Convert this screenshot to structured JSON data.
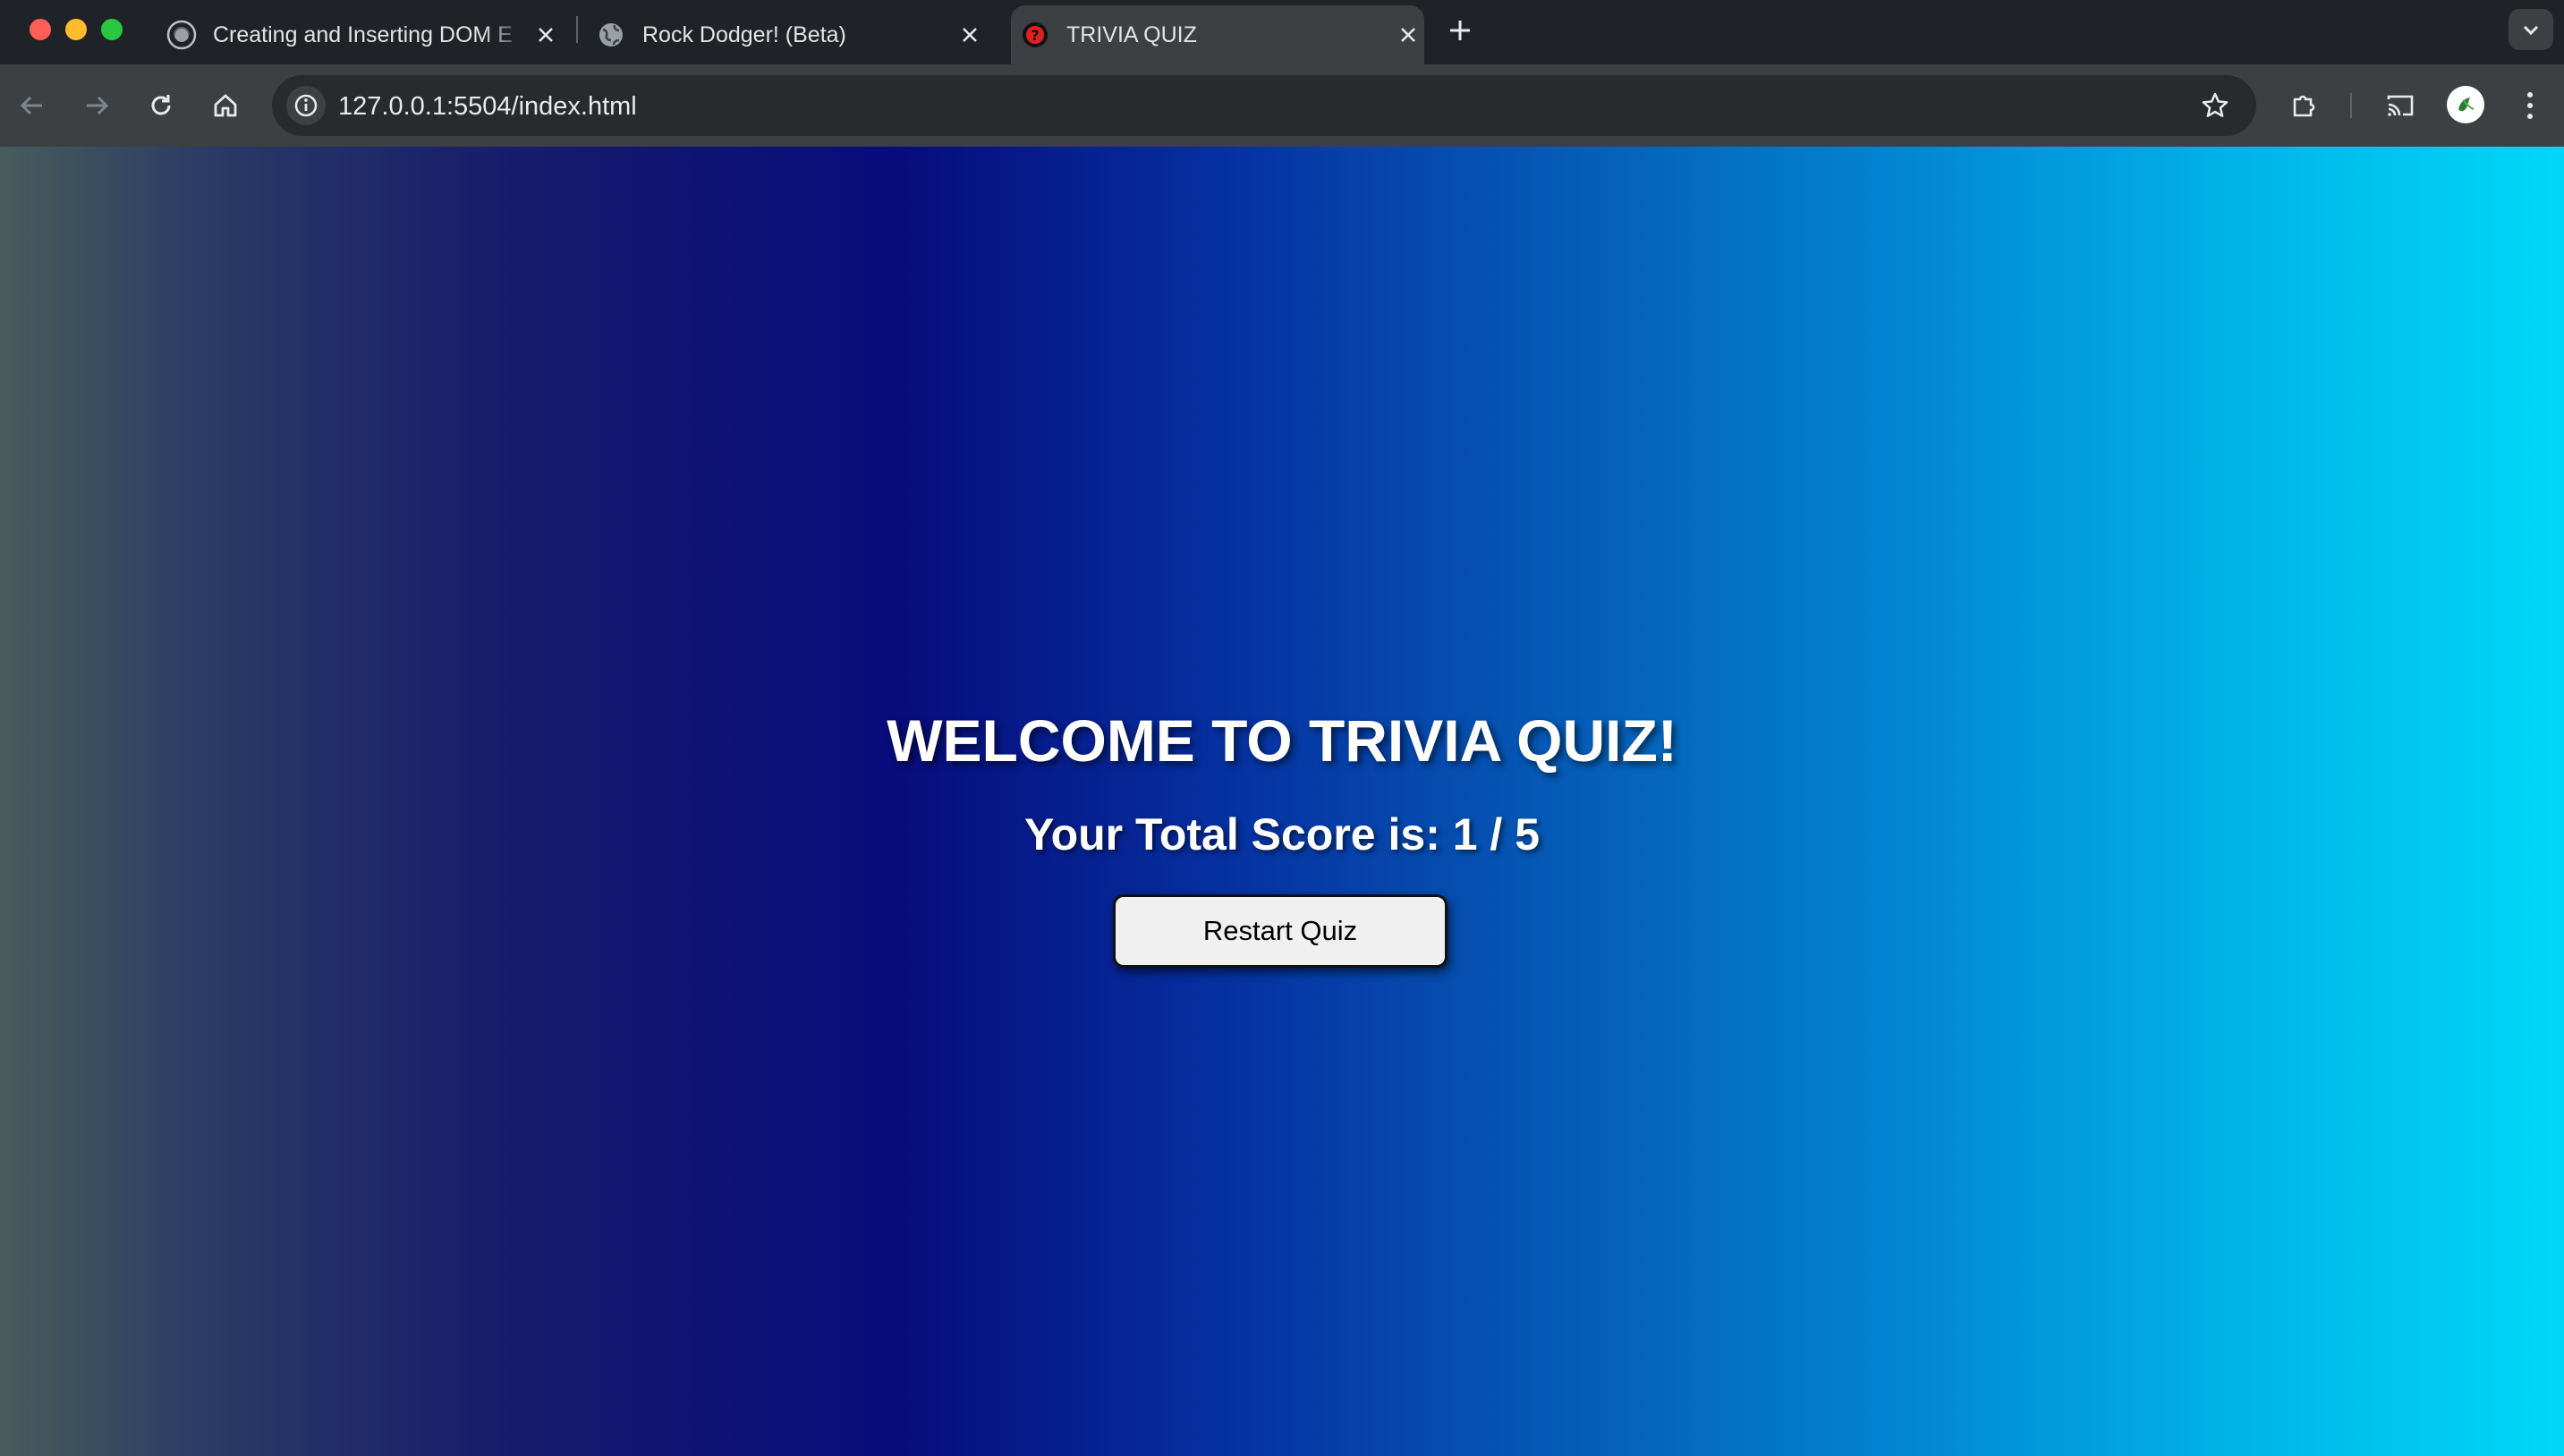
{
  "browser": {
    "tabs": [
      {
        "title": "Creating and Inserting DOM E",
        "favicon": "globe-icon",
        "active": false
      },
      {
        "title": "Rock Dodger! (Beta)",
        "favicon": "globe-icon",
        "active": false
      },
      {
        "title": "TRIVIA QUIZ",
        "favicon": "red-question-icon",
        "active": true
      }
    ],
    "url": "127.0.0.1:5504/index.html"
  },
  "page": {
    "title": "WELCOME TO TRIVIA QUIZ!",
    "score_text": "Your Total Score is: 1 / 5",
    "restart_label": "Restart Quiz"
  },
  "colors": {
    "gradient": [
      "#485d5b",
      "#070c7c",
      "#055eb8",
      "#00d7f8"
    ],
    "active_tab": "#3c4043",
    "tabstrip": "#1f2226"
  }
}
